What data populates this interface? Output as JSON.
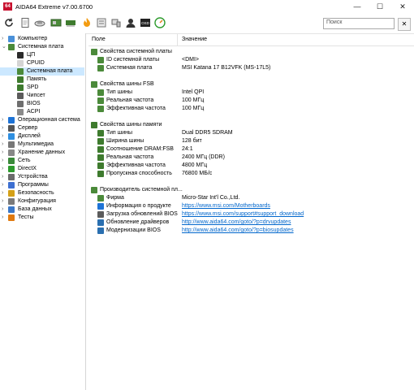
{
  "window": {
    "title": "AIDA64 Extreme v7.00.6700",
    "logo": "64",
    "minimize": "—",
    "maximize": "☐",
    "close": "✕"
  },
  "toolbar": {
    "search_placeholder": "Поиск",
    "search_btn": "✕"
  },
  "columns": {
    "field": "Поле",
    "value": "Значение"
  },
  "tree": [
    {
      "label": "Компьютер",
      "exp": "›",
      "icon": "#4a90d9",
      "child": false
    },
    {
      "label": "Системная плата",
      "exp": "⌄",
      "icon": "#4b8a3a",
      "child": false
    },
    {
      "label": "ЦП",
      "exp": "",
      "icon": "#2a2a2a",
      "child": true
    },
    {
      "label": "CPUID",
      "exp": "",
      "icon": "#d4d4d4",
      "child": true
    },
    {
      "label": "Системная плата",
      "exp": "",
      "icon": "#4b8a3a",
      "child": true,
      "selected": true
    },
    {
      "label": "Память",
      "exp": "",
      "icon": "#3e7b2e",
      "child": true
    },
    {
      "label": "SPD",
      "exp": "",
      "icon": "#3e7b2e",
      "child": true
    },
    {
      "label": "Чипсет",
      "exp": "",
      "icon": "#5b5b5b",
      "child": true
    },
    {
      "label": "BIOS",
      "exp": "",
      "icon": "#6e6e6e",
      "child": true
    },
    {
      "label": "ACPI",
      "exp": "",
      "icon": "#8a8a8a",
      "child": true
    },
    {
      "label": "Операционная система",
      "exp": "›",
      "icon": "#1e73d6",
      "child": false
    },
    {
      "label": "Сервер",
      "exp": "›",
      "icon": "#555",
      "child": false
    },
    {
      "label": "Дисплей",
      "exp": "›",
      "icon": "#2f8fe0",
      "child": false
    },
    {
      "label": "Мультимедиа",
      "exp": "›",
      "icon": "#777",
      "child": false
    },
    {
      "label": "Хранение данных",
      "exp": "›",
      "icon": "#888",
      "child": false
    },
    {
      "label": "Сеть",
      "exp": "›",
      "icon": "#3a8a3a",
      "child": false
    },
    {
      "label": "DirectX",
      "exp": "›",
      "icon": "#2d9b2d",
      "child": false
    },
    {
      "label": "Устройства",
      "exp": "›",
      "icon": "#6b6b6b",
      "child": false
    },
    {
      "label": "Программы",
      "exp": "›",
      "icon": "#3d6fd1",
      "child": false
    },
    {
      "label": "Безопасность",
      "exp": "›",
      "icon": "#d4a017",
      "child": false
    },
    {
      "label": "Конфигурация",
      "exp": "›",
      "icon": "#7a7a7a",
      "child": false
    },
    {
      "label": "База данных",
      "exp": "›",
      "icon": "#3b78c9",
      "child": false
    },
    {
      "label": "Тесты",
      "exp": "›",
      "icon": "#e07a10",
      "child": false
    }
  ],
  "rows": [
    {
      "key": "Свойства системной платы",
      "value": "",
      "indent": 0,
      "icon": "#4b8a3a"
    },
    {
      "key": "ID системной платы",
      "value": "<DMI>",
      "indent": 1,
      "icon": "#4b8a3a"
    },
    {
      "key": "Системная плата",
      "value": "MSI Katana 17 B12VFK (MS-17L5)",
      "indent": 1,
      "icon": "#4b8a3a"
    },
    {
      "key": "",
      "value": "",
      "indent": 0,
      "icon": ""
    },
    {
      "key": "Свойства шины FSB",
      "value": "",
      "indent": 0,
      "icon": "#4b8a3a"
    },
    {
      "key": "Тип шины",
      "value": "Intel QPI",
      "indent": 1,
      "icon": "#4b8a3a"
    },
    {
      "key": "Реальная частота",
      "value": "100 МГц",
      "indent": 1,
      "icon": "#4b8a3a"
    },
    {
      "key": "Эффективная частота",
      "value": "100 МГц",
      "indent": 1,
      "icon": "#4b8a3a"
    },
    {
      "key": "",
      "value": "",
      "indent": 0,
      "icon": ""
    },
    {
      "key": "Свойства шины памяти",
      "value": "",
      "indent": 0,
      "icon": "#3e7b2e"
    },
    {
      "key": "Тип шины",
      "value": "Dual DDR5 SDRAM",
      "indent": 1,
      "icon": "#3e7b2e"
    },
    {
      "key": "Ширина шины",
      "value": "128 бит",
      "indent": 1,
      "icon": "#3e7b2e"
    },
    {
      "key": "Соотношение DRAM:FSB",
      "value": "24:1",
      "indent": 1,
      "icon": "#3e7b2e"
    },
    {
      "key": "Реальная частота",
      "value": "2400 МГц (DDR)",
      "indent": 1,
      "icon": "#3e7b2e"
    },
    {
      "key": "Эффективная частота",
      "value": "4800 МГц",
      "indent": 1,
      "icon": "#3e7b2e"
    },
    {
      "key": "Пропускная способность",
      "value": "76800 МБ/с",
      "indent": 1,
      "icon": "#3e7b2e"
    },
    {
      "key": "",
      "value": "",
      "indent": 0,
      "icon": ""
    },
    {
      "key": "Производитель системной пл...",
      "value": "",
      "indent": 0,
      "icon": "#4b8a3a"
    },
    {
      "key": "Фирма",
      "value": "Micro-Star Int'l Co.,Ltd.",
      "indent": 1,
      "icon": "#4b8a3a"
    },
    {
      "key": "Информация о продукте",
      "value": "https://www.msi.com/Motherboards",
      "indent": 1,
      "icon": "#1e73d6",
      "link": true
    },
    {
      "key": "Загрузка обновлений BIOS",
      "value": "https://www.msi.com/support#support_download",
      "indent": 1,
      "icon": "#5b5b5b",
      "link": true
    },
    {
      "key": "Обновление драйверов",
      "value": "http://www.aida64.com/goto/?p=drvupdates",
      "indent": 1,
      "icon": "#2a6fb0",
      "link": true
    },
    {
      "key": "Модернизации BIOS",
      "value": "http://www.aida64.com/goto/?p=biosupdates",
      "indent": 1,
      "icon": "#2a6fb0",
      "link": true
    }
  ],
  "colors": {
    "accent": "#c8102e",
    "selection": "#cce8ff",
    "link": "#0066cc"
  }
}
